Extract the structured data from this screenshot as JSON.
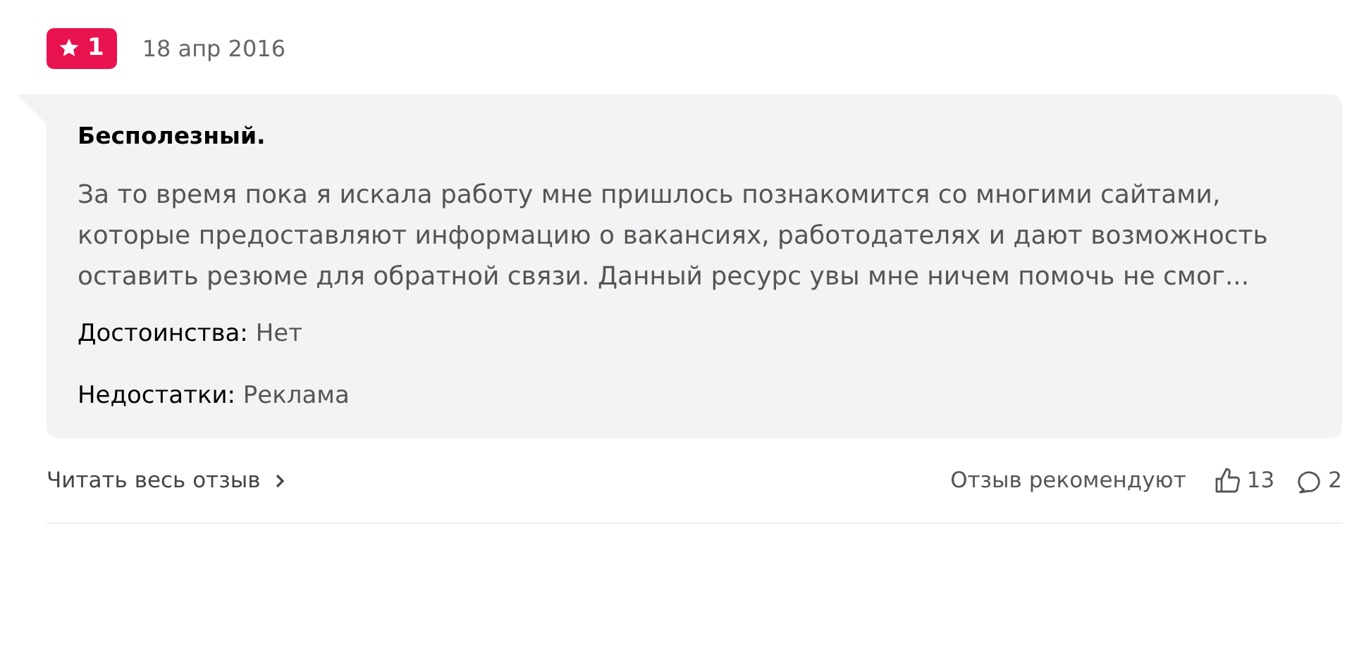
{
  "review": {
    "rating": "1",
    "date": "18 апр 2016",
    "title": "Бесполезный.",
    "text": "За то время пока я искала работу мне пришлось познакомится со многими сайтами, которые предоставляют информацию о вакансиях, работодателях и дают возможность оставить резюме для обратной связи. Данный ресурс увы мне ничем помочь не смог...",
    "pros": {
      "label": "Достоинства:",
      "value": "Нет"
    },
    "cons": {
      "label": "Недостатки:",
      "value": "Реклама"
    }
  },
  "footer": {
    "read_more": "Читать весь отзыв",
    "recommend_label": "Отзыв рекомендуют",
    "likes": "13",
    "comments": "2"
  }
}
